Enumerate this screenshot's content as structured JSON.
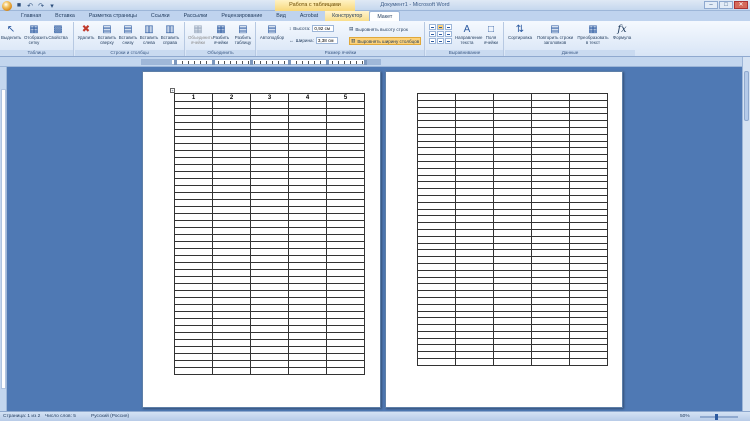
{
  "window": {
    "context_title": "Работа с таблицами",
    "doc_title": "Документ1 - Microsoft Word"
  },
  "tabs": [
    "Главная",
    "Вставка",
    "Разметка страницы",
    "Ссылки",
    "Рассылки",
    "Рецензирование",
    "Вид",
    "Acrobat",
    "Конструктор",
    "Макет"
  ],
  "ribbon": {
    "groups": {
      "table": "Таблица",
      "rows_cols": "Строки и столбцы",
      "merge": "Объединить",
      "cell_size": "Размер ячейки",
      "alignment": "Выравнивание",
      "data": "Данные"
    },
    "buttons": {
      "select": "Выделить",
      "gridlines": "Отобразить сетку",
      "properties": "Свойства",
      "delete": "Удалить",
      "insert_above": "Вставить сверху",
      "insert_below": "Вставить снизу",
      "insert_left": "Вставить слева",
      "insert_right": "Вставить справа",
      "merge_cells": "Объединить ячейки",
      "split_cells": "Разбить ячейки",
      "split_table": "Разбить таблицу",
      "autofit": "Автоподбор",
      "height_label": "Высота:",
      "height_value": "0,92 см",
      "width_label": "Ширина:",
      "width_value": "3,38 см",
      "distribute_rows": "Выровнять высоту строк",
      "distribute_cols": "Выровнять ширину столбцов",
      "text_direction": "Направление текста",
      "cell_margins": "Поля ячейки",
      "sort": "Сортировка",
      "repeat_header": "Повторить строки заголовков",
      "convert_text": "Преобразовать в текст",
      "formula": "Формула"
    }
  },
  "table1": {
    "headers": [
      "1",
      "2",
      "3",
      "4",
      "5"
    ],
    "body_rows": 39
  },
  "table2": {
    "rows": 40,
    "cols": 5
  },
  "statusbar": {
    "page": "Страница: 1 из 2",
    "words": "Число слов: 5",
    "language": "Русский (Россия)",
    "zoom": "50%"
  },
  "icons": {
    "office": "office-button-icon",
    "save": "save-icon",
    "undo": "undo-icon",
    "redo": "redo-icon"
  }
}
